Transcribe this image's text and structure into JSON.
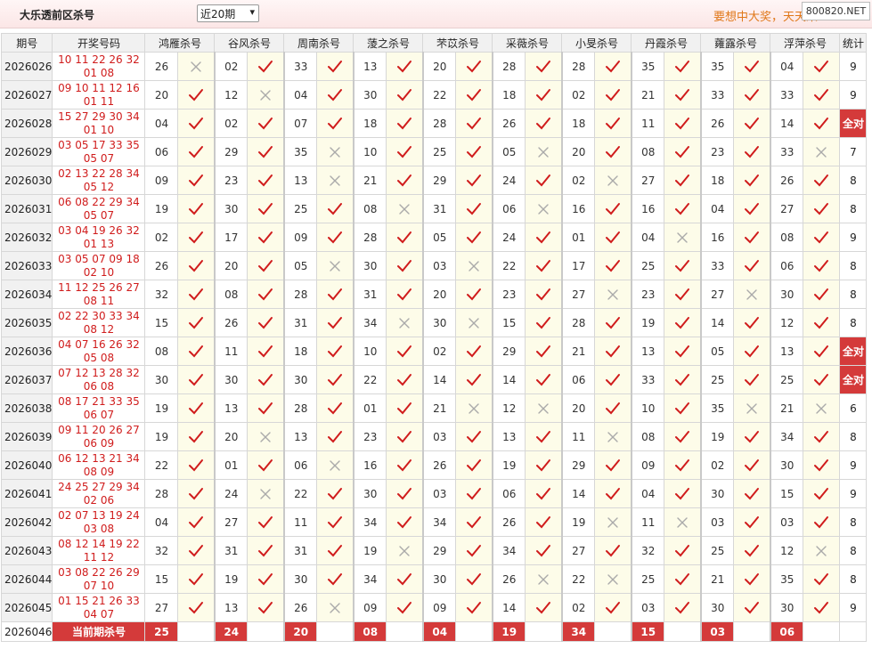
{
  "header": {
    "title": "大乐透前区杀号",
    "period_select": "近20期",
    "promo_text": "要想中大奖，天天来",
    "site_badge": "800820.NET"
  },
  "columns": {
    "period": "期号",
    "draw": "开奖号码",
    "experts": [
      "鸿雁杀号",
      "谷风杀号",
      "周南杀号",
      "蔆之杀号",
      "芣苡杀号",
      "采薇杀号",
      "小旻杀号",
      "丹霞杀号",
      "蕹露杀号",
      "浮萍杀号"
    ],
    "stat": "统计"
  },
  "rows": [
    {
      "period": "2026026",
      "front": "10 11 22 26 32",
      "back": "01 08",
      "kills": [
        "26",
        "02",
        "33",
        "13",
        "20",
        "28",
        "28",
        "35",
        "35",
        "04"
      ],
      "ok": [
        0,
        1,
        1,
        1,
        1,
        1,
        1,
        1,
        1,
        1
      ],
      "stat": "9"
    },
    {
      "period": "2026027",
      "front": "09 10 11 12 16",
      "back": "01 11",
      "kills": [
        "20",
        "12",
        "04",
        "30",
        "22",
        "18",
        "02",
        "21",
        "33",
        "33"
      ],
      "ok": [
        1,
        0,
        1,
        1,
        1,
        1,
        1,
        1,
        1,
        1
      ],
      "stat": "9"
    },
    {
      "period": "2026028",
      "front": "15 27 29 30 34",
      "back": "01 10",
      "kills": [
        "04",
        "02",
        "07",
        "18",
        "28",
        "26",
        "18",
        "11",
        "26",
        "14"
      ],
      "ok": [
        1,
        1,
        1,
        1,
        1,
        1,
        1,
        1,
        1,
        1
      ],
      "stat": "全对"
    },
    {
      "period": "2026029",
      "front": "03 05 17 33 35",
      "back": "05 07",
      "kills": [
        "06",
        "29",
        "35",
        "10",
        "25",
        "05",
        "20",
        "08",
        "23",
        "33"
      ],
      "ok": [
        1,
        1,
        0,
        1,
        1,
        0,
        1,
        1,
        1,
        0
      ],
      "stat": "7"
    },
    {
      "period": "2026030",
      "front": "02 13 22 28 34",
      "back": "05 12",
      "kills": [
        "09",
        "23",
        "13",
        "21",
        "29",
        "24",
        "02",
        "27",
        "18",
        "26"
      ],
      "ok": [
        1,
        1,
        0,
        1,
        1,
        1,
        0,
        1,
        1,
        1
      ],
      "stat": "8"
    },
    {
      "period": "2026031",
      "front": "06 08 22 29 34",
      "back": "05 07",
      "kills": [
        "19",
        "30",
        "25",
        "08",
        "31",
        "06",
        "16",
        "16",
        "04",
        "27"
      ],
      "ok": [
        1,
        1,
        1,
        0,
        1,
        0,
        1,
        1,
        1,
        1
      ],
      "stat": "8"
    },
    {
      "period": "2026032",
      "front": "03 04 19 26 32",
      "back": "01 13",
      "kills": [
        "02",
        "17",
        "09",
        "28",
        "05",
        "24",
        "01",
        "04",
        "16",
        "08"
      ],
      "ok": [
        1,
        1,
        1,
        1,
        1,
        1,
        1,
        0,
        1,
        1
      ],
      "stat": "9"
    },
    {
      "period": "2026033",
      "front": "03 05 07 09 18",
      "back": "02 10",
      "kills": [
        "26",
        "20",
        "05",
        "30",
        "03",
        "22",
        "17",
        "25",
        "33",
        "06"
      ],
      "ok": [
        1,
        1,
        0,
        1,
        0,
        1,
        1,
        1,
        1,
        1
      ],
      "stat": "8"
    },
    {
      "period": "2026034",
      "front": "11 12 25 26 27",
      "back": "08 11",
      "kills": [
        "32",
        "08",
        "28",
        "31",
        "20",
        "23",
        "27",
        "23",
        "27",
        "30"
      ],
      "ok": [
        1,
        1,
        1,
        1,
        1,
        1,
        0,
        1,
        0,
        1
      ],
      "stat": "8"
    },
    {
      "period": "2026035",
      "front": "02 22 30 33 34",
      "back": "08 12",
      "kills": [
        "15",
        "26",
        "31",
        "34",
        "30",
        "15",
        "28",
        "19",
        "14",
        "12"
      ],
      "ok": [
        1,
        1,
        1,
        0,
        0,
        1,
        1,
        1,
        1,
        1
      ],
      "stat": "8"
    },
    {
      "period": "2026036",
      "front": "04 07 16 26 32",
      "back": "05 08",
      "kills": [
        "08",
        "11",
        "18",
        "10",
        "02",
        "29",
        "21",
        "13",
        "05",
        "13"
      ],
      "ok": [
        1,
        1,
        1,
        1,
        1,
        1,
        1,
        1,
        1,
        1
      ],
      "stat": "全对"
    },
    {
      "period": "2026037",
      "front": "07 12 13 28 32",
      "back": "06 08",
      "kills": [
        "30",
        "30",
        "30",
        "22",
        "14",
        "14",
        "06",
        "33",
        "25",
        "25"
      ],
      "ok": [
        1,
        1,
        1,
        1,
        1,
        1,
        1,
        1,
        1,
        1
      ],
      "stat": "全对"
    },
    {
      "period": "2026038",
      "front": "08 17 21 33 35",
      "back": "06 07",
      "kills": [
        "19",
        "13",
        "28",
        "01",
        "21",
        "12",
        "20",
        "10",
        "35",
        "21"
      ],
      "ok": [
        1,
        1,
        1,
        1,
        0,
        0,
        1,
        1,
        0,
        0
      ],
      "stat": "6"
    },
    {
      "period": "2026039",
      "front": "09 11 20 26 27",
      "back": "06 09",
      "kills": [
        "19",
        "20",
        "13",
        "23",
        "03",
        "13",
        "11",
        "08",
        "19",
        "34"
      ],
      "ok": [
        1,
        0,
        1,
        1,
        1,
        1,
        0,
        1,
        1,
        1
      ],
      "stat": "8"
    },
    {
      "period": "2026040",
      "front": "06 12 13 21 34",
      "back": "08 09",
      "kills": [
        "22",
        "01",
        "06",
        "16",
        "26",
        "19",
        "29",
        "09",
        "02",
        "30"
      ],
      "ok": [
        1,
        1,
        0,
        1,
        1,
        1,
        1,
        1,
        1,
        1
      ],
      "stat": "9"
    },
    {
      "period": "2026041",
      "front": "24 25 27 29 34",
      "back": "02 06",
      "kills": [
        "28",
        "24",
        "22",
        "30",
        "03",
        "06",
        "14",
        "04",
        "30",
        "15"
      ],
      "ok": [
        1,
        0,
        1,
        1,
        1,
        1,
        1,
        1,
        1,
        1
      ],
      "stat": "9"
    },
    {
      "period": "2026042",
      "front": "02 07 13 19 24",
      "back": "03 08",
      "kills": [
        "04",
        "27",
        "11",
        "34",
        "34",
        "26",
        "19",
        "11",
        "03",
        "03"
      ],
      "ok": [
        1,
        1,
        1,
        1,
        1,
        1,
        0,
        0,
        1,
        1
      ],
      "stat": "8"
    },
    {
      "period": "2026043",
      "front": "08 12 14 19 22",
      "back": "11 12",
      "kills": [
        "32",
        "31",
        "31",
        "19",
        "29",
        "34",
        "27",
        "32",
        "25",
        "12"
      ],
      "ok": [
        1,
        1,
        1,
        0,
        1,
        1,
        1,
        1,
        1,
        0
      ],
      "stat": "8"
    },
    {
      "period": "2026044",
      "front": "03 08 22 26 29",
      "back": "07 10",
      "kills": [
        "15",
        "19",
        "30",
        "34",
        "30",
        "26",
        "22",
        "25",
        "21",
        "35"
      ],
      "ok": [
        1,
        1,
        1,
        1,
        1,
        0,
        0,
        1,
        1,
        1
      ],
      "stat": "8"
    },
    {
      "period": "2026045",
      "front": "01 15 21 26 33",
      "back": "04 07",
      "kills": [
        "27",
        "13",
        "26",
        "09",
        "09",
        "14",
        "02",
        "03",
        "30",
        "30"
      ],
      "ok": [
        1,
        1,
        0,
        1,
        1,
        1,
        1,
        1,
        1,
        1
      ],
      "stat": "9"
    }
  ],
  "current": {
    "period": "2026046",
    "label": "当前期杀号",
    "kills": [
      "25",
      "24",
      "20",
      "08",
      "04",
      "19",
      "34",
      "15",
      "03",
      "06"
    ]
  },
  "colors": {
    "accent": "#d43a3a",
    "draw_red": "#d01c1c",
    "check": "#d01c1c",
    "cross": "#aaaaaa",
    "mark_bg": "#fdfce9"
  }
}
